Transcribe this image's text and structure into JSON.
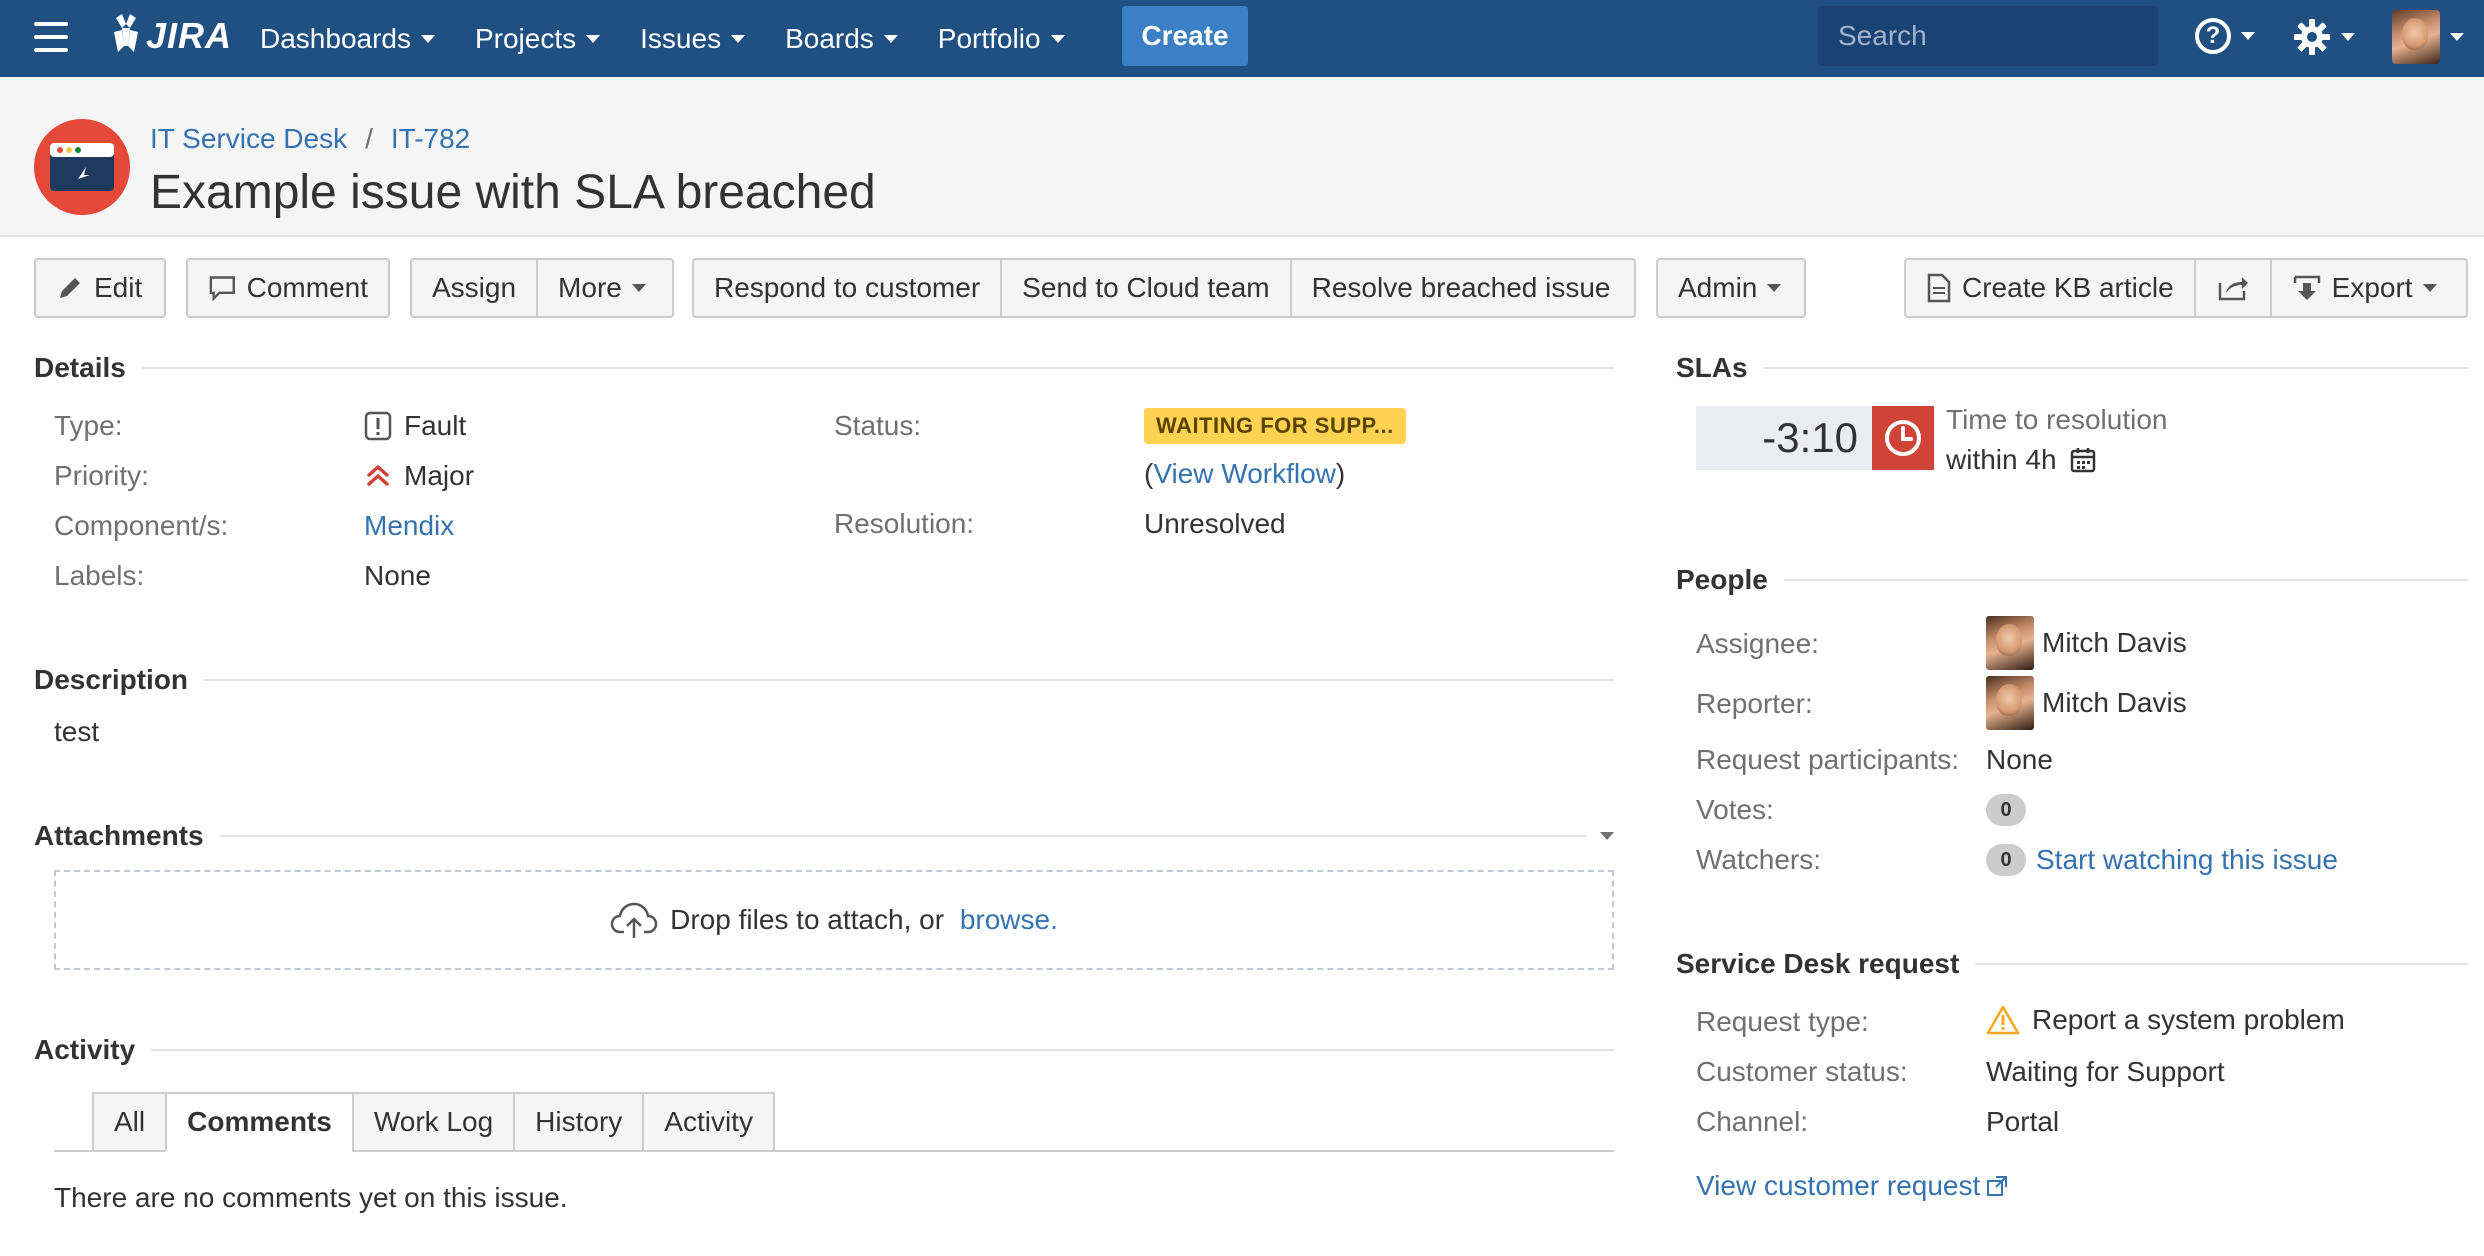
{
  "nav": {
    "logo_text": "JIRA",
    "items": [
      "Dashboards",
      "Projects",
      "Issues",
      "Boards",
      "Portfolio"
    ],
    "create_label": "Create",
    "search_placeholder": "Search"
  },
  "header": {
    "project_name": "IT Service Desk",
    "issue_key": "IT-782",
    "breadcrumb_sep": "/",
    "title": "Example issue with SLA breached"
  },
  "toolbar": {
    "edit": "Edit",
    "comment": "Comment",
    "assign": "Assign",
    "more": "More",
    "respond": "Respond to customer",
    "send_cloud": "Send to Cloud team",
    "resolve": "Resolve breached issue",
    "admin": "Admin",
    "create_kb": "Create KB article",
    "export": "Export"
  },
  "details": {
    "heading": "Details",
    "type_label": "Type:",
    "type_value": "Fault",
    "priority_label": "Priority:",
    "priority_value": "Major",
    "components_label": "Component/s:",
    "components_value": "Mendix",
    "labels_label": "Labels:",
    "labels_value": "None",
    "status_label": "Status:",
    "status_value": "WAITING FOR SUPP...",
    "view_workflow_open": "(",
    "view_workflow": "View Workflow",
    "view_workflow_close": ")",
    "resolution_label": "Resolution:",
    "resolution_value": "Unresolved"
  },
  "description": {
    "heading": "Description",
    "text": "test"
  },
  "attachments": {
    "heading": "Attachments",
    "drop_text": "Drop files to attach, or ",
    "browse": "browse."
  },
  "activity": {
    "heading": "Activity",
    "tabs": [
      "All",
      "Comments",
      "Work Log",
      "History",
      "Activity"
    ],
    "active_tab": "Comments",
    "empty": "There are no comments yet on this issue."
  },
  "slas": {
    "heading": "SLAs",
    "time": "-3:10",
    "name": "Time to resolution",
    "goal": "within 4h"
  },
  "people": {
    "heading": "People",
    "assignee_label": "Assignee:",
    "assignee": "Mitch Davis",
    "reporter_label": "Reporter:",
    "reporter": "Mitch Davis",
    "participants_label": "Request participants:",
    "participants": "None",
    "votes_label": "Votes:",
    "votes": "0",
    "watchers_label": "Watchers:",
    "watchers": "0",
    "watch_link": "Start watching this issue"
  },
  "service_desk": {
    "heading": "Service Desk request",
    "request_type_label": "Request type:",
    "request_type": "Report a system problem",
    "customer_status_label": "Customer status:",
    "customer_status": "Waiting for Support",
    "channel_label": "Channel:",
    "channel": "Portal",
    "view_request": "View customer request"
  },
  "colors": {
    "nav_bg": "#205081",
    "create_btn": "#3b7fc4",
    "status_lozenge": "#ffd351",
    "sla_breached": "#d04437",
    "link": "#3572b0"
  }
}
